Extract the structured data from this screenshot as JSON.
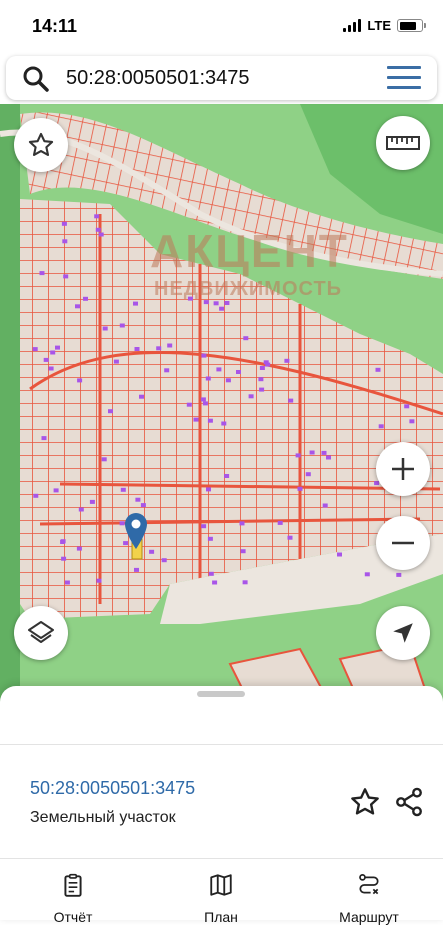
{
  "status_bar": {
    "time": "14:11",
    "network": "LTE",
    "battery_level": 0.8
  },
  "search": {
    "query": "50:28:0050501:3475"
  },
  "map": {
    "watermark_big": "АКЦЕНТ",
    "watermark_small": "НЕДВИЖИМОСТЬ",
    "colors": {
      "land": "#8fd186",
      "road": "#ece6df",
      "parcel_fill": "#e7dcd3",
      "parcel_border": "#e8553d",
      "building": "#a855e8",
      "marker": "#2f6aa8",
      "marker_flag": "#f2d24a"
    }
  },
  "controls": {
    "favorite_icon": "star-icon",
    "ruler_icon": "ruler-icon",
    "zoom_in_icon": "plus-icon",
    "zoom_out_icon": "minus-icon",
    "layers_icon": "layers-icon",
    "locate_icon": "navigation-arrow-icon"
  },
  "sheet": {
    "cadastral_number": "50:28:0050501:3475",
    "object_type": "Земельный участок"
  },
  "bottom_nav": [
    {
      "label": "Отчёт",
      "icon": "report-icon"
    },
    {
      "label": "План",
      "icon": "map-icon"
    },
    {
      "label": "Маршрут",
      "icon": "route-icon"
    }
  ]
}
